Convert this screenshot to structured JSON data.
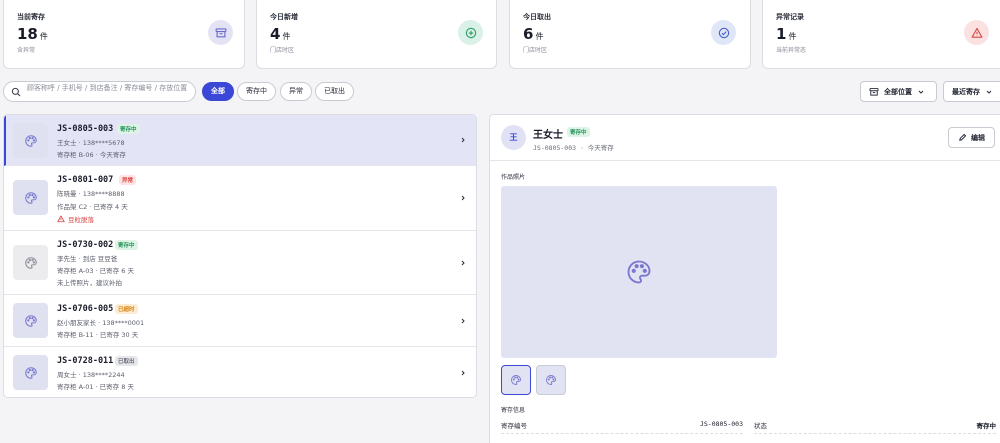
{
  "stats": [
    {
      "label": "当前寄存",
      "value": "18",
      "unit": "件",
      "sub": "含异常",
      "icon": "archive-box-icon",
      "color": "#6b68c9",
      "bg": "#e4e3f5"
    },
    {
      "label": "今日新增",
      "value": "4",
      "unit": "件",
      "sub": "门店时区",
      "icon": "plus-circle-icon",
      "color": "#2e9e6a",
      "bg": "#d9f1e6"
    },
    {
      "label": "今日取出",
      "value": "6",
      "unit": "件",
      "sub": "门店时区",
      "icon": "check-circle-icon",
      "color": "#4a62c9",
      "bg": "#dfe6f7"
    },
    {
      "label": "异常记录",
      "value": "1",
      "unit": "件",
      "sub": "当前异常态",
      "icon": "warning-triangle-icon",
      "color": "#d9453f",
      "bg": "#fbe1e1"
    }
  ],
  "filters": {
    "search_placeholder": "顾客称呼 / 手机号 / 到店备注 / 寄存编号 / 存放位置",
    "pills": [
      "全部",
      "寄存中",
      "异常",
      "已取出"
    ],
    "location_label": "全部位置",
    "sort_label": "最近寄存"
  },
  "list": [
    {
      "id": "JS-0805-003",
      "badge": "寄存中",
      "line1": "王女士 · 138****5678",
      "line2": "寄存柜 B-06 · 今天寄存",
      "line3": ""
    },
    {
      "id": "JS-0801-007",
      "badge": "异常",
      "line1": "陈晓曼 · 138****8888",
      "line2": "作品架 C2 · 已寄存 4 天",
      "line3": "豆粒脱落"
    },
    {
      "id": "JS-0730-002",
      "badge": "寄存中",
      "line1": "李先生 · 到店 豆豆爸",
      "line2": "寄存柜 A-03 · 已寄存 6 天",
      "line3": "未上传照片，建议补拍"
    },
    {
      "id": "JS-0706-005",
      "badge": "已超时",
      "line1": "赵小朋友家长 · 138****0001",
      "line2": "寄存柜 B-11 · 已寄存 30 天",
      "line3": ""
    },
    {
      "id": "JS-0728-011",
      "badge": "已取出",
      "line1": "周女士 · 138****2244",
      "line2": "寄存柜 A-01 · 已寄存 8 天",
      "line3": ""
    }
  ],
  "detail": {
    "avatar": "王",
    "name": "王女士",
    "badge": "寄存中",
    "sub": "JS-0805-003 · 今天寄存",
    "edit_label": "编辑",
    "photos_label": "作品照片",
    "info_title": "寄存信息",
    "info": {
      "id_key": "寄存编号",
      "id_value": "JS-0805-003",
      "status_key": "状态",
      "status_value": "寄存中"
    }
  },
  "colors": {
    "accent": "#3b47d6",
    "palette_icon": "#7a78cf"
  }
}
